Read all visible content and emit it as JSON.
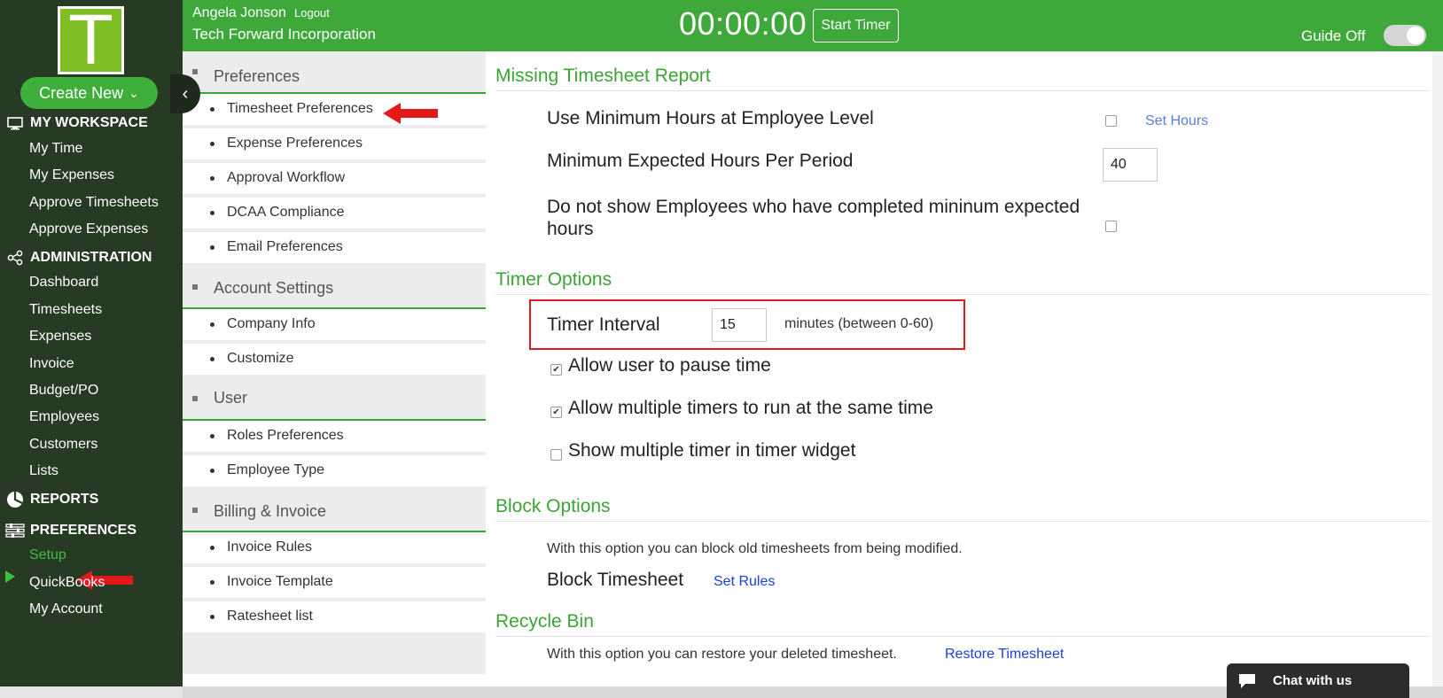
{
  "header": {
    "user_name": "Angela Jonson",
    "logout_label": "Logout",
    "company_name": "Tech Forward Incorporation",
    "timer_display": "00:00:00",
    "start_timer_label": "Start Timer",
    "guide_label": "Guide Off"
  },
  "sidebar": {
    "logo_letter": "T",
    "create_new_label": "Create New",
    "sections": {
      "workspace": "MY WORKSPACE",
      "administration": "ADMINISTRATION",
      "reports": "REPORTS",
      "preferences": "PREFERENCES"
    },
    "workspace_items": [
      "My Time",
      "My Expenses",
      "Approve Timesheets",
      "Approve Expenses"
    ],
    "admin_items": [
      "Dashboard",
      "Timesheets",
      "Expenses",
      "Invoice",
      "Budget/PO",
      "Employees",
      "Customers",
      "Lists"
    ],
    "pref_items": [
      "Setup",
      "QuickBooks",
      "My Account"
    ],
    "active_item": "Setup"
  },
  "settings_nav": {
    "groups": [
      {
        "title": "Preferences",
        "items": [
          "Timesheet Preferences",
          "Expense Preferences",
          "Approval Workflow",
          "DCAA Compliance",
          "Email Preferences"
        ]
      },
      {
        "title": "Account Settings",
        "items": [
          "Company Info",
          "Customize"
        ]
      },
      {
        "title": "User",
        "items": [
          "Roles Preferences",
          "Employee Type"
        ]
      },
      {
        "title": "Billing & Invoice",
        "items": [
          "Invoice Rules",
          "Invoice Template",
          "Ratesheet list"
        ]
      }
    ],
    "collapse_glyph": "‹"
  },
  "main": {
    "missing_report": {
      "title": "Missing Timesheet Report",
      "use_min_hours_label": "Use Minimum Hours at Employee Level",
      "use_min_hours_checked": false,
      "set_hours_link": "Set Hours",
      "min_expected_label": "Minimum Expected Hours Per Period",
      "min_expected_value": "40",
      "do_not_show_label_line1": "Do not show Employees who have completed mininum expected",
      "do_not_show_label_line2": "hours",
      "do_not_show_checked": false
    },
    "timer_options": {
      "title": "Timer Options",
      "interval_label": "Timer Interval",
      "interval_value": "15",
      "interval_hint": "minutes (between 0-60)",
      "options": [
        {
          "label": "Allow user to pause time",
          "checked": true
        },
        {
          "label": "Allow multiple timers to run at the same time",
          "checked": true
        },
        {
          "label": "Show multiple timer in timer widget",
          "checked": false
        }
      ]
    },
    "block_options": {
      "title": "Block Options",
      "description": "With this option you can block old timesheets from being modified.",
      "block_label": "Block Timesheet",
      "set_rules_link": "Set Rules"
    },
    "recycle_bin": {
      "title": "Recycle Bin",
      "description": "With this option you can restore your deleted timesheet.",
      "restore_link": "Restore Timesheet"
    }
  },
  "chat": {
    "label": "Chat with us"
  },
  "colors": {
    "brand_green": "#3ea93a",
    "sidebar_bg": "#273a23",
    "section_green": "#3aa533",
    "highlight_red": "#e2191a",
    "link_blue": "#1a3fe0"
  }
}
